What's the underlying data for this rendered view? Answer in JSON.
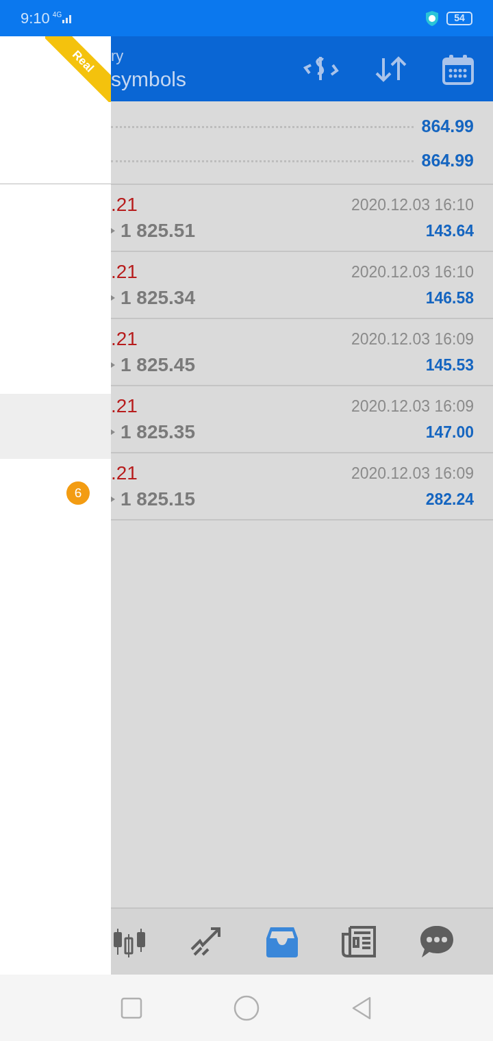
{
  "status_bar": {
    "time": "9:10",
    "network": "4G",
    "battery": "54"
  },
  "drawer": {
    "account_type": "Real",
    "badge": "6"
  },
  "app_bar": {
    "title": "ry",
    "subtitle": "symbols"
  },
  "summary": [
    {
      "value": "864.99"
    },
    {
      "value": "864.99"
    }
  ],
  "deals": [
    {
      "price_partial": ".21",
      "prices": "1 825.51",
      "time": "2020.12.03 16:10",
      "profit": "143.64"
    },
    {
      "price_partial": ".21",
      "prices": "1 825.34",
      "time": "2020.12.03 16:10",
      "profit": "146.58"
    },
    {
      "price_partial": ".21",
      "prices": "1 825.45",
      "time": "2020.12.03 16:09",
      "profit": "145.53"
    },
    {
      "price_partial": ".21",
      "prices": "1 825.35",
      "time": "2020.12.03 16:09",
      "profit": "147.00"
    },
    {
      "price_partial": ".21",
      "prices": "1 825.15",
      "time": "2020.12.03 16:09",
      "profit": "282.24"
    }
  ],
  "bottom_nav": [
    {
      "kind": "chart",
      "selected": false
    },
    {
      "kind": "trade",
      "selected": false
    },
    {
      "kind": "history",
      "selected": true
    },
    {
      "kind": "news",
      "selected": false
    },
    {
      "kind": "chat",
      "selected": false
    }
  ]
}
